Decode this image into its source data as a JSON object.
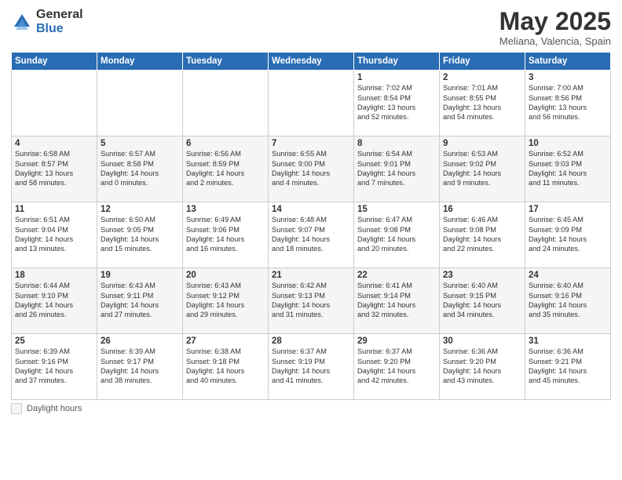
{
  "logo": {
    "general": "General",
    "blue": "Blue"
  },
  "title": "May 2025",
  "subtitle": "Meliana, Valencia, Spain",
  "days_of_week": [
    "Sunday",
    "Monday",
    "Tuesday",
    "Wednesday",
    "Thursday",
    "Friday",
    "Saturday"
  ],
  "legend": {
    "label": "Daylight hours"
  },
  "weeks": [
    [
      {
        "day": "",
        "info": ""
      },
      {
        "day": "",
        "info": ""
      },
      {
        "day": "",
        "info": ""
      },
      {
        "day": "",
        "info": ""
      },
      {
        "day": "1",
        "info": "Sunrise: 7:02 AM\nSunset: 8:54 PM\nDaylight: 13 hours\nand 52 minutes."
      },
      {
        "day": "2",
        "info": "Sunrise: 7:01 AM\nSunset: 8:55 PM\nDaylight: 13 hours\nand 54 minutes."
      },
      {
        "day": "3",
        "info": "Sunrise: 7:00 AM\nSunset: 8:56 PM\nDaylight: 13 hours\nand 56 minutes."
      }
    ],
    [
      {
        "day": "4",
        "info": "Sunrise: 6:58 AM\nSunset: 8:57 PM\nDaylight: 13 hours\nand 58 minutes."
      },
      {
        "day": "5",
        "info": "Sunrise: 6:57 AM\nSunset: 8:58 PM\nDaylight: 14 hours\nand 0 minutes."
      },
      {
        "day": "6",
        "info": "Sunrise: 6:56 AM\nSunset: 8:59 PM\nDaylight: 14 hours\nand 2 minutes."
      },
      {
        "day": "7",
        "info": "Sunrise: 6:55 AM\nSunset: 9:00 PM\nDaylight: 14 hours\nand 4 minutes."
      },
      {
        "day": "8",
        "info": "Sunrise: 6:54 AM\nSunset: 9:01 PM\nDaylight: 14 hours\nand 7 minutes."
      },
      {
        "day": "9",
        "info": "Sunrise: 6:53 AM\nSunset: 9:02 PM\nDaylight: 14 hours\nand 9 minutes."
      },
      {
        "day": "10",
        "info": "Sunrise: 6:52 AM\nSunset: 9:03 PM\nDaylight: 14 hours\nand 11 minutes."
      }
    ],
    [
      {
        "day": "11",
        "info": "Sunrise: 6:51 AM\nSunset: 9:04 PM\nDaylight: 14 hours\nand 13 minutes."
      },
      {
        "day": "12",
        "info": "Sunrise: 6:50 AM\nSunset: 9:05 PM\nDaylight: 14 hours\nand 15 minutes."
      },
      {
        "day": "13",
        "info": "Sunrise: 6:49 AM\nSunset: 9:06 PM\nDaylight: 14 hours\nand 16 minutes."
      },
      {
        "day": "14",
        "info": "Sunrise: 6:48 AM\nSunset: 9:07 PM\nDaylight: 14 hours\nand 18 minutes."
      },
      {
        "day": "15",
        "info": "Sunrise: 6:47 AM\nSunset: 9:08 PM\nDaylight: 14 hours\nand 20 minutes."
      },
      {
        "day": "16",
        "info": "Sunrise: 6:46 AM\nSunset: 9:08 PM\nDaylight: 14 hours\nand 22 minutes."
      },
      {
        "day": "17",
        "info": "Sunrise: 6:45 AM\nSunset: 9:09 PM\nDaylight: 14 hours\nand 24 minutes."
      }
    ],
    [
      {
        "day": "18",
        "info": "Sunrise: 6:44 AM\nSunset: 9:10 PM\nDaylight: 14 hours\nand 26 minutes."
      },
      {
        "day": "19",
        "info": "Sunrise: 6:43 AM\nSunset: 9:11 PM\nDaylight: 14 hours\nand 27 minutes."
      },
      {
        "day": "20",
        "info": "Sunrise: 6:43 AM\nSunset: 9:12 PM\nDaylight: 14 hours\nand 29 minutes."
      },
      {
        "day": "21",
        "info": "Sunrise: 6:42 AM\nSunset: 9:13 PM\nDaylight: 14 hours\nand 31 minutes."
      },
      {
        "day": "22",
        "info": "Sunrise: 6:41 AM\nSunset: 9:14 PM\nDaylight: 14 hours\nand 32 minutes."
      },
      {
        "day": "23",
        "info": "Sunrise: 6:40 AM\nSunset: 9:15 PM\nDaylight: 14 hours\nand 34 minutes."
      },
      {
        "day": "24",
        "info": "Sunrise: 6:40 AM\nSunset: 9:16 PM\nDaylight: 14 hours\nand 35 minutes."
      }
    ],
    [
      {
        "day": "25",
        "info": "Sunrise: 6:39 AM\nSunset: 9:16 PM\nDaylight: 14 hours\nand 37 minutes."
      },
      {
        "day": "26",
        "info": "Sunrise: 6:39 AM\nSunset: 9:17 PM\nDaylight: 14 hours\nand 38 minutes."
      },
      {
        "day": "27",
        "info": "Sunrise: 6:38 AM\nSunset: 9:18 PM\nDaylight: 14 hours\nand 40 minutes."
      },
      {
        "day": "28",
        "info": "Sunrise: 6:37 AM\nSunset: 9:19 PM\nDaylight: 14 hours\nand 41 minutes."
      },
      {
        "day": "29",
        "info": "Sunrise: 6:37 AM\nSunset: 9:20 PM\nDaylight: 14 hours\nand 42 minutes."
      },
      {
        "day": "30",
        "info": "Sunrise: 6:36 AM\nSunset: 9:20 PM\nDaylight: 14 hours\nand 43 minutes."
      },
      {
        "day": "31",
        "info": "Sunrise: 6:36 AM\nSunset: 9:21 PM\nDaylight: 14 hours\nand 45 minutes."
      }
    ]
  ]
}
